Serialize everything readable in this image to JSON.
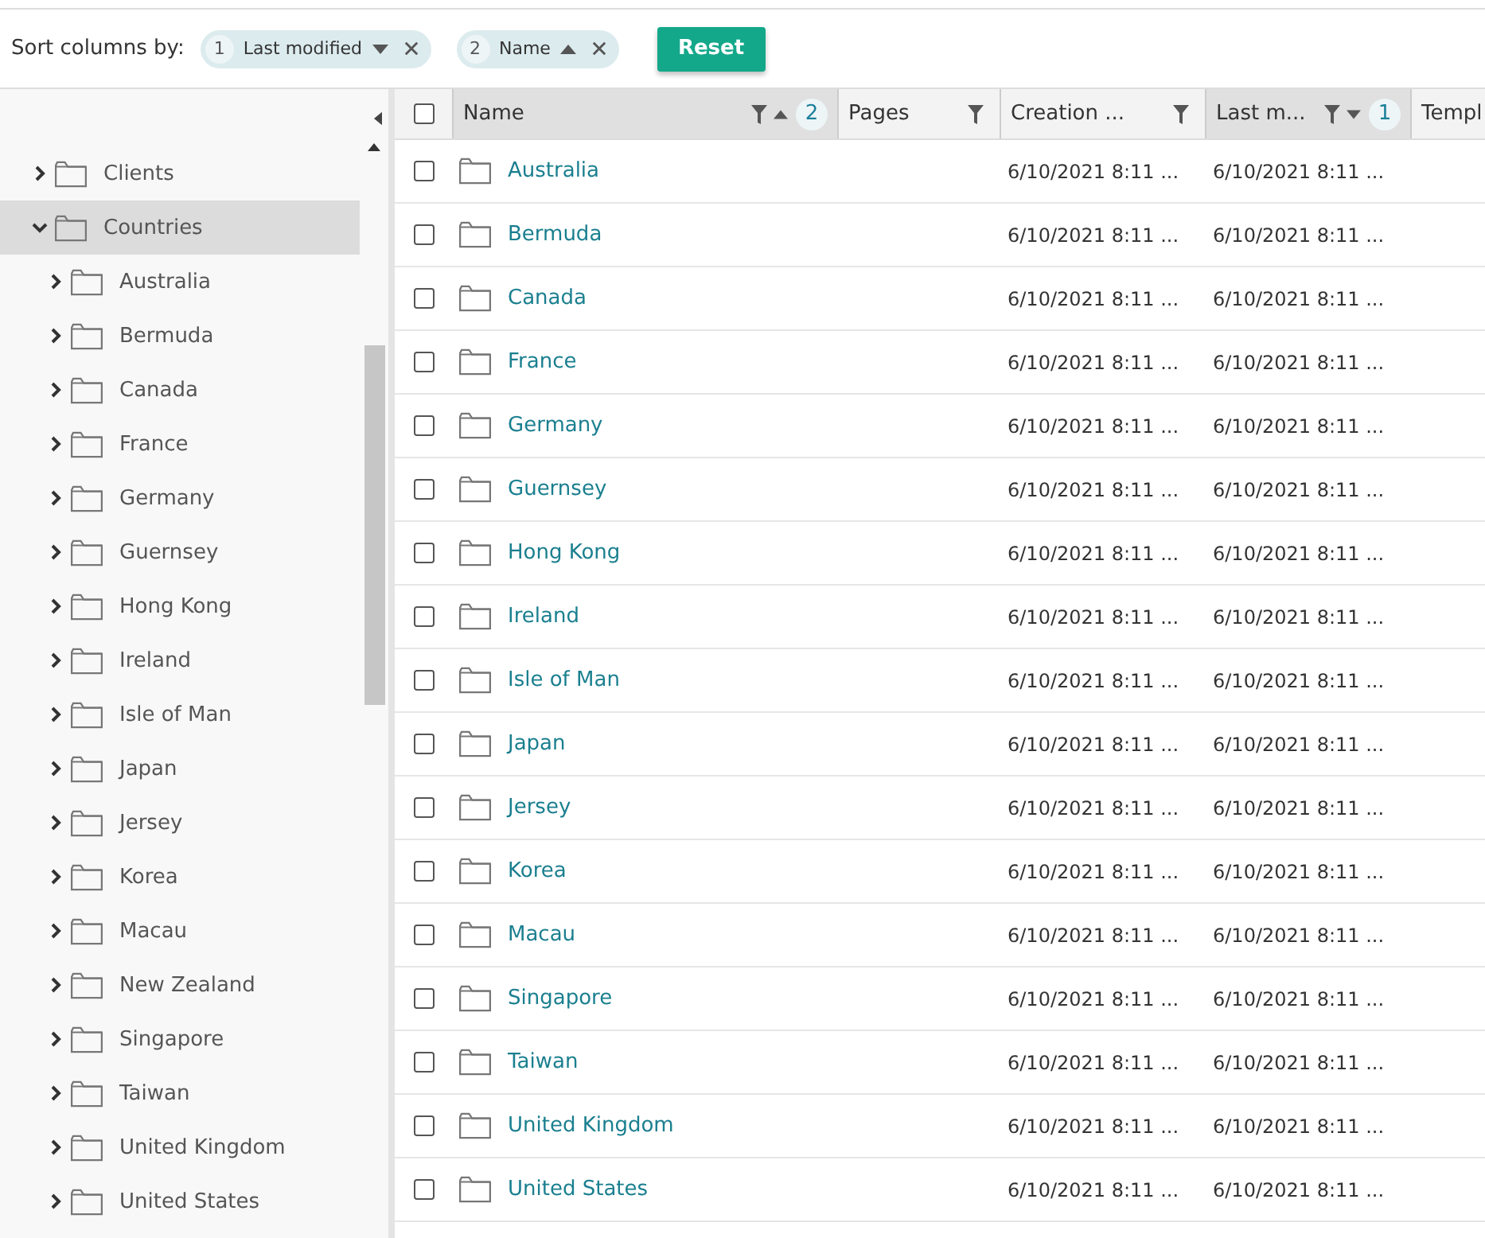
{
  "toolbar": {
    "label": "Sort columns by:",
    "chips": [
      {
        "order": "1",
        "label": "Last modified",
        "ascending": false
      },
      {
        "order": "2",
        "label": "Name",
        "ascending": true
      }
    ],
    "reset": "Reset"
  },
  "tree": [
    {
      "label": "Clients",
      "expanded": false,
      "selected": false
    },
    {
      "label": "Countries",
      "expanded": true,
      "selected": true,
      "children": [
        {
          "label": "Australia",
          "expanded": false,
          "selected": false
        },
        {
          "label": "Bermuda",
          "expanded": false,
          "selected": false
        },
        {
          "label": "Canada",
          "expanded": false,
          "selected": false
        },
        {
          "label": "France",
          "expanded": false,
          "selected": false
        },
        {
          "label": "Germany",
          "expanded": false,
          "selected": false
        },
        {
          "label": "Guernsey",
          "expanded": false,
          "selected": false
        },
        {
          "label": "Hong Kong",
          "expanded": false,
          "selected": false
        },
        {
          "label": "Ireland",
          "expanded": false,
          "selected": false
        },
        {
          "label": "Isle of Man",
          "expanded": false,
          "selected": false
        },
        {
          "label": "Japan",
          "expanded": false,
          "selected": false
        },
        {
          "label": "Jersey",
          "expanded": false,
          "selected": false
        },
        {
          "label": "Korea",
          "expanded": false,
          "selected": false
        },
        {
          "label": "Macau",
          "expanded": false,
          "selected": false
        },
        {
          "label": "New Zealand",
          "expanded": false,
          "selected": false
        },
        {
          "label": "Singapore",
          "expanded": false,
          "selected": false
        },
        {
          "label": "Taiwan",
          "expanded": false,
          "selected": false
        },
        {
          "label": "United Kingdom",
          "expanded": false,
          "selected": false
        },
        {
          "label": "United States",
          "expanded": false,
          "selected": false
        }
      ]
    }
  ],
  "table": {
    "select_all_checked": false,
    "columns": [
      {
        "label": "Name",
        "filter": true,
        "sorted": true,
        "ascending": true,
        "sort_order": "2"
      },
      {
        "label": "Pages",
        "filter": true,
        "sorted": false
      },
      {
        "label": "Creation ...",
        "filter": true,
        "sorted": false
      },
      {
        "label": "Last m...",
        "filter": true,
        "sorted": true,
        "ascending": false,
        "sort_order": "1"
      },
      {
        "label": "Templ",
        "sorted": false
      }
    ],
    "rows": [
      {
        "name": "Australia",
        "created": "6/10/2021 8:11 ...",
        "modified": "6/10/2021 8:11 ...",
        "checked": false
      },
      {
        "name": "Bermuda",
        "created": "6/10/2021 8:11 ...",
        "modified": "6/10/2021 8:11 ...",
        "checked": false
      },
      {
        "name": "Canada",
        "created": "6/10/2021 8:11 ...",
        "modified": "6/10/2021 8:11 ...",
        "checked": false
      },
      {
        "name": "France",
        "created": "6/10/2021 8:11 ...",
        "modified": "6/10/2021 8:11 ...",
        "checked": false
      },
      {
        "name": "Germany",
        "created": "6/10/2021 8:11 ...",
        "modified": "6/10/2021 8:11 ...",
        "checked": false
      },
      {
        "name": "Guernsey",
        "created": "6/10/2021 8:11 ...",
        "modified": "6/10/2021 8:11 ...",
        "checked": false
      },
      {
        "name": "Hong Kong",
        "created": "6/10/2021 8:11 ...",
        "modified": "6/10/2021 8:11 ...",
        "checked": false
      },
      {
        "name": "Ireland",
        "created": "6/10/2021 8:11 ...",
        "modified": "6/10/2021 8:11 ...",
        "checked": false
      },
      {
        "name": "Isle of Man",
        "created": "6/10/2021 8:11 ...",
        "modified": "6/10/2021 8:11 ...",
        "checked": false
      },
      {
        "name": "Japan",
        "created": "6/10/2021 8:11 ...",
        "modified": "6/10/2021 8:11 ...",
        "checked": false
      },
      {
        "name": "Jersey",
        "created": "6/10/2021 8:11 ...",
        "modified": "6/10/2021 8:11 ...",
        "checked": false
      },
      {
        "name": "Korea",
        "created": "6/10/2021 8:11 ...",
        "modified": "6/10/2021 8:11 ...",
        "checked": false
      },
      {
        "name": "Macau",
        "created": "6/10/2021 8:11 ...",
        "modified": "6/10/2021 8:11 ...",
        "checked": false
      },
      {
        "name": "Singapore",
        "created": "6/10/2021 8:11 ...",
        "modified": "6/10/2021 8:11 ...",
        "checked": false
      },
      {
        "name": "Taiwan",
        "created": "6/10/2021 8:11 ...",
        "modified": "6/10/2021 8:11 ...",
        "checked": false
      },
      {
        "name": "United Kingdom",
        "created": "6/10/2021 8:11 ...",
        "modified": "6/10/2021 8:11 ...",
        "checked": false
      },
      {
        "name": "United States",
        "created": "6/10/2021 8:11 ...",
        "modified": "6/10/2021 8:11 ...",
        "checked": false
      }
    ]
  }
}
